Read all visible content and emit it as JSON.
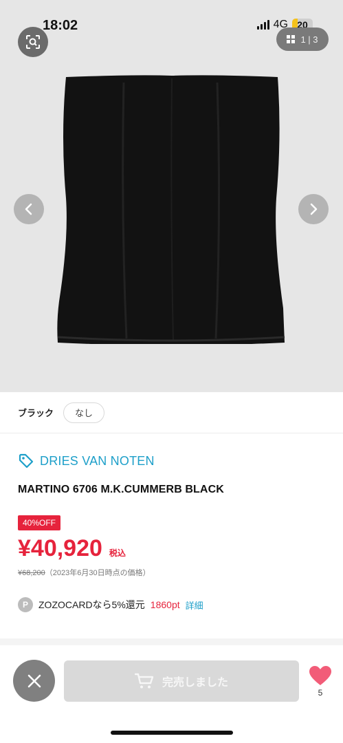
{
  "status_bar": {
    "time": "18:02",
    "network": "4G",
    "battery": "20"
  },
  "gallery": {
    "counter": "1 | 3",
    "icons": {
      "zoom": "zoom-search-icon",
      "grid": "grid-icon",
      "prev": "chevron-left-icon",
      "next": "chevron-right-icon"
    }
  },
  "variant": {
    "color_label": "ブラック",
    "size_label": "なし"
  },
  "product": {
    "brand": "DRIES VAN NOTEN",
    "name": "MARTINO 6706 M.K.CUMMERB BLACK",
    "discount_badge": "40%OFF",
    "price": "¥40,920",
    "tax_label": "税込",
    "old_price": "¥68,200",
    "old_price_note": "（2023年6月30日時点の価格）"
  },
  "zozocard": {
    "badge": "P",
    "text": "ZOZOCARDなら5%還元",
    "points": "1860pt",
    "detail": "詳細"
  },
  "bottom_bar": {
    "soldout_label": "完売しました",
    "favorite_count": "5"
  },
  "colors": {
    "accent_blue": "#1d9fc9",
    "sale_red": "#e6233c",
    "heart_pink": "#f25c78"
  }
}
